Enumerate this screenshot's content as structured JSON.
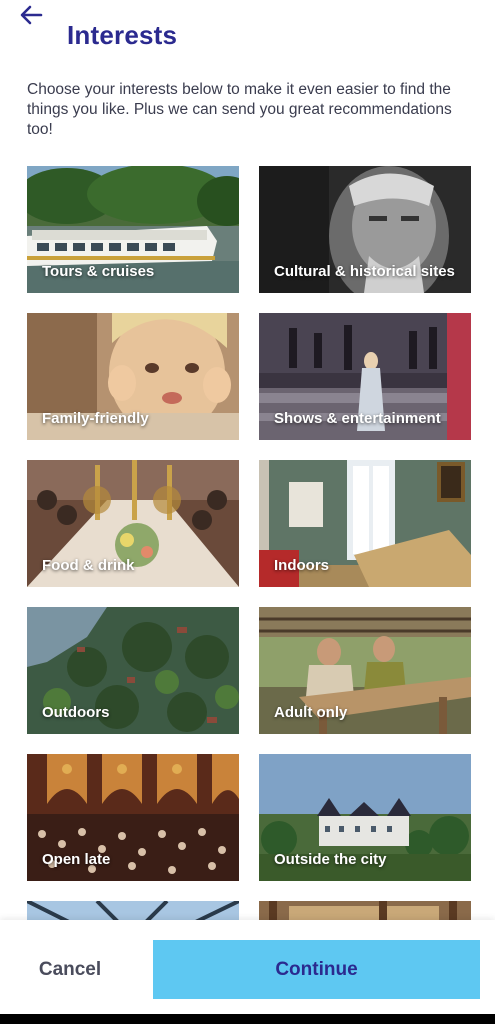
{
  "header": {
    "title": "Interests",
    "back_icon": "arrow-left-icon",
    "intro": "Choose your interests below to make it even easier to find the things you like. Plus we can send you great recommendations too!"
  },
  "colors": {
    "title": "#2b2a8f",
    "accent": "#5ec8f2",
    "body_text": "#3a3c4e"
  },
  "interests": [
    {
      "label": "Tours & cruises"
    },
    {
      "label": "Cultural & historical sites"
    },
    {
      "label": "Family-friendly"
    },
    {
      "label": "Shows & entertainment"
    },
    {
      "label": "Food & drink"
    },
    {
      "label": "Indoors"
    },
    {
      "label": "Outdoors"
    },
    {
      "label": "Adult only"
    },
    {
      "label": "Open late"
    },
    {
      "label": "Outside the city"
    },
    {
      "label": ""
    },
    {
      "label": ""
    }
  ],
  "footer": {
    "cancel_label": "Cancel",
    "continue_label": "Continue"
  }
}
